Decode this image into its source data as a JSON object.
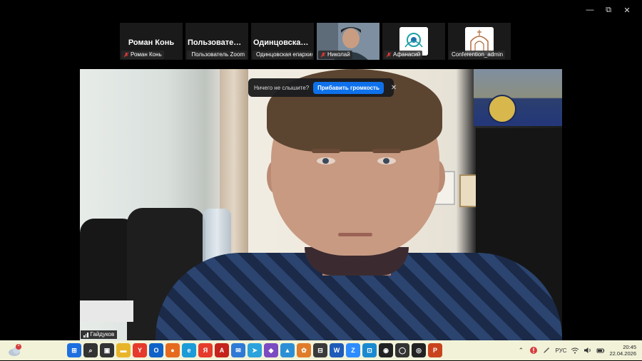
{
  "window": {
    "minimize_glyph": "—",
    "maximize_glyph": "⧉",
    "close_glyph": "✕"
  },
  "participants": [
    {
      "display_name": "Роман Конь",
      "label": "Роман Конь",
      "muted": true,
      "kind": "name"
    },
    {
      "display_name": "Пользователь...",
      "label": "Пользователь Zoom",
      "muted": true,
      "kind": "name"
    },
    {
      "display_name": "Одинцовская е...",
      "label": "Одинцовская епархия, п...",
      "muted": true,
      "kind": "name"
    },
    {
      "display_name": "",
      "label": "Николай",
      "muted": true,
      "kind": "video"
    },
    {
      "display_name": "",
      "label": "Афанасий",
      "muted": true,
      "kind": "logo"
    },
    {
      "display_name": "",
      "label": "Conferention_admin",
      "muted": false,
      "kind": "logo"
    }
  ],
  "notice": {
    "text": "Ничего не слышите?",
    "button": "Прибавить громкость",
    "close_glyph": "✕"
  },
  "active_speaker": {
    "label": "Гайдуков"
  },
  "taskbar": {
    "weather_badge": "1",
    "apps": [
      {
        "name": "start",
        "glyph": "⊞",
        "color": "#1d6fe0"
      },
      {
        "name": "search",
        "glyph": "⌕",
        "color": "#333333"
      },
      {
        "name": "task-view",
        "glyph": "▣",
        "color": "#333333"
      },
      {
        "name": "file-explorer",
        "glyph": "▬",
        "color": "#e8b52a"
      },
      {
        "name": "yandex",
        "glyph": "Y",
        "color": "#e53a2c"
      },
      {
        "name": "outlook",
        "glyph": "O",
        "color": "#0f62c7"
      },
      {
        "name": "firefox",
        "glyph": "●",
        "color": "#e66a1e"
      },
      {
        "name": "edge",
        "glyph": "e",
        "color": "#1b9bd8"
      },
      {
        "name": "yandex-browser",
        "glyph": "Я",
        "color": "#e53a2c"
      },
      {
        "name": "acrobat",
        "glyph": "A",
        "color": "#c4241c"
      },
      {
        "name": "mail",
        "glyph": "✉",
        "color": "#2f7ad6"
      },
      {
        "name": "telegram",
        "glyph": "➤",
        "color": "#2aa3dd"
      },
      {
        "name": "app-purple",
        "glyph": "◆",
        "color": "#7b4bc2"
      },
      {
        "name": "photos",
        "glyph": "▲",
        "color": "#2c8fd6"
      },
      {
        "name": "paint",
        "glyph": "✿",
        "color": "#e07b2a"
      },
      {
        "name": "calculator",
        "glyph": "⊟",
        "color": "#3a3a3a"
      },
      {
        "name": "word",
        "glyph": "W",
        "color": "#1f5bb8"
      },
      {
        "name": "zoom",
        "glyph": "Z",
        "color": "#2d8cff"
      },
      {
        "name": "store",
        "glyph": "⊡",
        "color": "#1a8ad0"
      },
      {
        "name": "obs",
        "glyph": "◉",
        "color": "#222222"
      },
      {
        "name": "whatsapp",
        "glyph": "◯",
        "color": "#333333"
      },
      {
        "name": "app-dark",
        "glyph": "◎",
        "color": "#222222"
      },
      {
        "name": "powerpoint",
        "glyph": "P",
        "color": "#c9431e"
      }
    ],
    "tray": {
      "chevron": "⌃",
      "lang": "РУС",
      "time": "20:45",
      "date": "22.04.2026"
    }
  }
}
